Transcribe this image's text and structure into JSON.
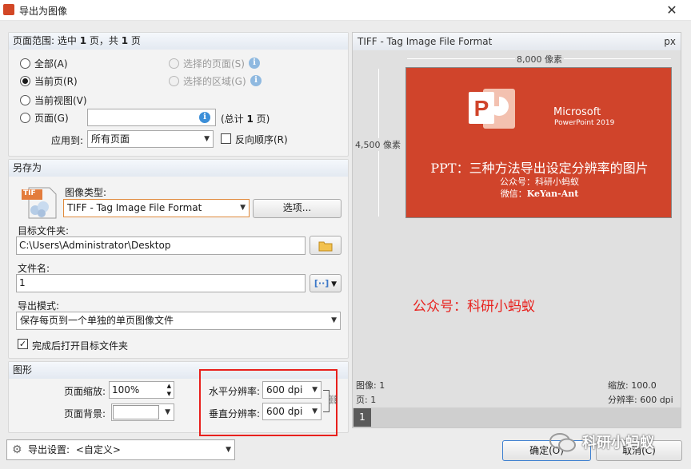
{
  "window": {
    "title": "导出为图像",
    "close": "✕"
  },
  "page_range": {
    "title_prefix": "页面范围: 选中 ",
    "selected": "1",
    "title_mid": " 页，共 ",
    "total": "1",
    "title_suffix": " 页",
    "options": {
      "all": "全部(A)",
      "current_page": "当前页(R)",
      "current_view": "当前视图(V)",
      "pages": "页面(G)",
      "selected_pages": "选择的页面(S)",
      "selected_area": "选择的区域(G)"
    },
    "pages_input": "",
    "total_note_prefix": "(总计 ",
    "total_note_count": "1",
    "total_note_suffix": " 页)",
    "apply_to_label": "应用到:",
    "apply_to_value": "所有页面",
    "reverse_order": "反向顺序(R)"
  },
  "save_as": {
    "title": "另存为",
    "tif_icon_text": "TIF",
    "image_type_label": "图像类型:",
    "image_type_value": "TIFF - Tag Image File Format",
    "options_button": "选项...",
    "target_folder_label": "目标文件夹:",
    "target_folder_value": "C:\\Users\\Administrator\\Desktop",
    "filename_label": "文件名:",
    "filename_value": "1",
    "export_mode_label": "导出模式:",
    "export_mode_value": "保存每页到一个单独的单页图像文件",
    "open_folder_after": "完成后打开目标文件夹"
  },
  "graphics": {
    "title": "图形",
    "page_zoom_label": "页面缩放:",
    "page_zoom_value": "100%",
    "page_bg_label": "页面背景:",
    "h_res_label": "水平分辨率:",
    "h_res_value": "600 dpi",
    "v_res_label": "垂直分辨率:",
    "v_res_value": "600 dpi"
  },
  "footer": {
    "export_settings_label": "导出设置:",
    "export_settings_value": "<自定义>",
    "ok": "确定(O)",
    "cancel": "取消(C)"
  },
  "preview": {
    "format": "TIFF - Tag Image File Format",
    "unit": "px",
    "width_label": "8,000 像素",
    "height_label": "4,500 像素",
    "slide": {
      "brand1": "Microsoft",
      "brand2": "PowerPoint 2019",
      "title": "PPT：三种方法导出设定分辨率的图片",
      "line1": "公众号：科研小蚂蚁",
      "line2_prefix": "微信：",
      "line2_value": "KeYan-Ant"
    },
    "watermark": "公众号：科研小蚂蚁",
    "image_label": "图像: 1",
    "page_label": "页: 1",
    "zoom_label": "缩放: 100.0",
    "resolution_label": "分辨率: 600 dpi",
    "page_number": "1"
  },
  "overlay_watermark": "科研小蚂蚁",
  "colors": {
    "accent": "#3c8fd8",
    "slide": "#d0442b",
    "highlight": "#e8201c",
    "watermark": "#e8201c"
  }
}
